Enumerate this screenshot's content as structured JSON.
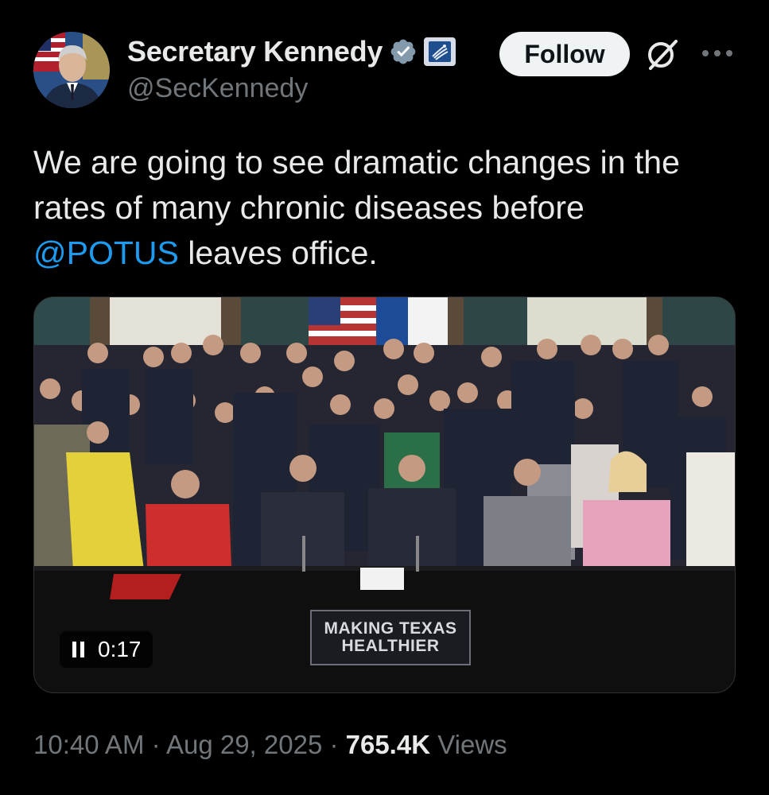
{
  "author": {
    "display_name": "Secretary Kennedy",
    "handle": "@SecKennedy",
    "verified_icon": "verified-badge-icon",
    "affiliation_icon": "hhs-eagle-badge-icon"
  },
  "actions": {
    "follow_label": "Follow",
    "grok_icon": "grok-icon",
    "more_icon": "more-horizontal-icon"
  },
  "tweet": {
    "text_part1": "We are going to see dramatic changes in the rates of many chronic diseases before ",
    "mention": "@POTUS",
    "text_part2": " leaves office."
  },
  "media": {
    "sign_line1": "MAKING TEXAS",
    "sign_line2": "HEALTHIER",
    "time": "0:17",
    "state_icon": "pause-icon"
  },
  "meta": {
    "time": "10:40 AM",
    "separator": " · ",
    "date": "Aug 29, 2025",
    "views_count": "765.4K",
    "views_label": " Views"
  },
  "colors": {
    "background": "#000000",
    "text": "#e7e9ea",
    "secondary": "#71767b",
    "link": "#1d9bf0",
    "follow_bg": "#eff3f4"
  }
}
